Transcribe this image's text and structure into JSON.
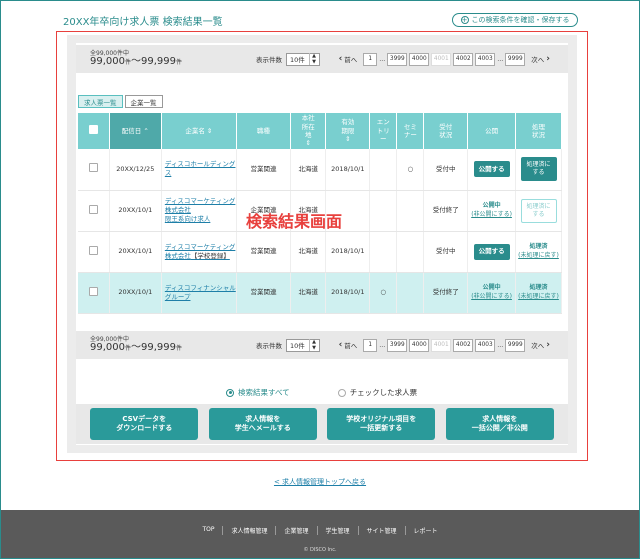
{
  "header": {
    "title": "20XX年卒向け求人票 検索結果一覧",
    "save_label": "この検索条件を確認・保存する"
  },
  "count_bar": {
    "total_label": "全99,000件中",
    "range_from": "99,000",
    "range_to": "～99,999",
    "unit": "件",
    "per_page_label": "表示件数",
    "per_page_value": "10件"
  },
  "pager": {
    "prev": "前へ",
    "next": "次へ",
    "pages": [
      "1",
      "3999",
      "4000",
      "4001",
      "4002",
      "4003",
      "9999"
    ],
    "dots": "…"
  },
  "tabs": [
    "求人票一覧",
    "企業一覧"
  ],
  "table": {
    "headers": [
      "配信日",
      "企業名",
      "職種",
      "本社\n所在\n地",
      "有効\n期限",
      "エン\nトリ\nー",
      "セミ\nナー",
      "受付\n状況",
      "公開",
      "処理\n状況"
    ],
    "rows": [
      {
        "date": "20XX/12/25",
        "company": "ディスコホールディングス",
        "company_suffix": "",
        "job": "営業関連",
        "location": "北海道",
        "expiry": "2018/10/1",
        "entry": "",
        "seminar": "○",
        "status": "受付中",
        "publish_btn": "公開する",
        "process": "処理済に\nする"
      },
      {
        "date": "20XX/10/1",
        "company": "ディスコマーケティング株式会社\n限王系向け求人",
        "company_suffix": "",
        "job": "企業関連",
        "location": "北海道",
        "expiry": "",
        "entry": "",
        "seminar": "",
        "status": "受付終了",
        "publish_label": "公開中",
        "publish_link": "(非公開にする)",
        "process": "処理済に\nする"
      },
      {
        "date": "20XX/10/1",
        "company": "ディスコマーケティング株式会社",
        "company_suffix": "【学校登録】",
        "job": "営業関連",
        "location": "北海道",
        "expiry": "2018/10/1",
        "entry": "",
        "seminar": "",
        "status": "受付中",
        "publish_btn": "公開する",
        "process_label": "処理済",
        "process_link": "(未処理に戻す)"
      },
      {
        "date": "20XX/10/1",
        "company": "ディスコフィナンシャルグループ",
        "company_suffix": "",
        "job": "営業関連",
        "location": "北海道",
        "expiry": "2018/10/1",
        "entry": "○",
        "seminar": "",
        "status": "受付終了",
        "publish_label": "公開中",
        "publish_link": "(非公開にする)",
        "process_label": "処理済",
        "process_link": "(未処理に戻す)"
      }
    ]
  },
  "overlay_label": "検索結果画面",
  "radios": [
    "検索結果すべて",
    "チェックした求人票"
  ],
  "actions": [
    "CSVデータを\nダウンロードする",
    "求人情報を\n学生へメールする",
    "学校オリジナル項目を\n一括更新する",
    "求人情報を\n一括公開／非公開"
  ],
  "back_link": "< 求人情報管理トップへ戻る",
  "footer": {
    "nav": [
      "TOP",
      "求人情報管理",
      "企業管理",
      "学生管理",
      "サイト管理",
      "レポート"
    ],
    "copyright": "© DISCO Inc."
  }
}
